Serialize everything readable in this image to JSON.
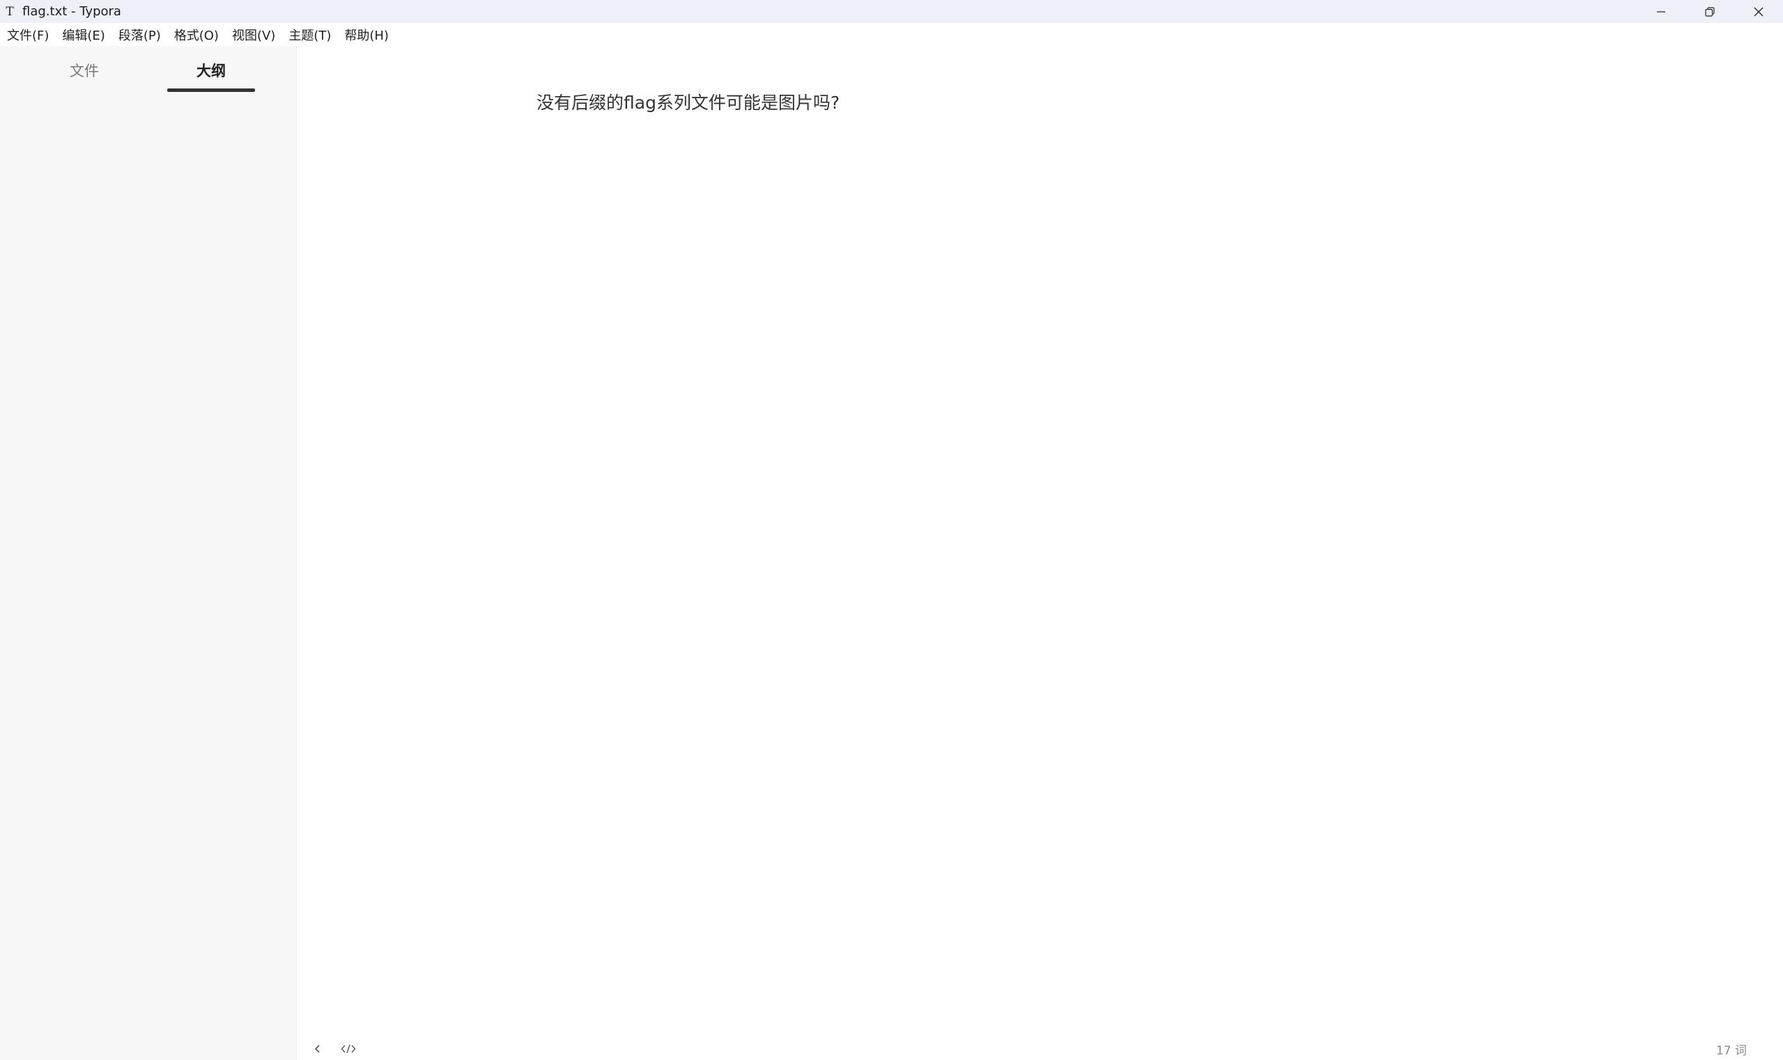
{
  "window": {
    "title": "flag.txt - Typora",
    "app_icon_glyph": "T",
    "controls": [
      "minimize-icon",
      "restore-icon",
      "close-icon"
    ]
  },
  "menubar": {
    "items": [
      {
        "label": "文件(F)"
      },
      {
        "label": "编辑(E)"
      },
      {
        "label": "段落(P)"
      },
      {
        "label": "格式(O)"
      },
      {
        "label": "视图(V)"
      },
      {
        "label": "主题(T)"
      },
      {
        "label": "帮助(H)"
      }
    ]
  },
  "sidebar": {
    "tabs": [
      {
        "label": "文件",
        "active": false
      },
      {
        "label": "大纲",
        "active": true
      }
    ]
  },
  "editor": {
    "paragraph": "没有后缀的flag系列文件可能是图片吗?"
  },
  "footer": {
    "word_count": "17 词",
    "icons": [
      "chevron-left-icon",
      "source-code-icon"
    ]
  },
  "colors": {
    "titlebar_bg": "#edf1f7",
    "sidebar_bg": "#f7f7f7",
    "accent": "#333333"
  }
}
